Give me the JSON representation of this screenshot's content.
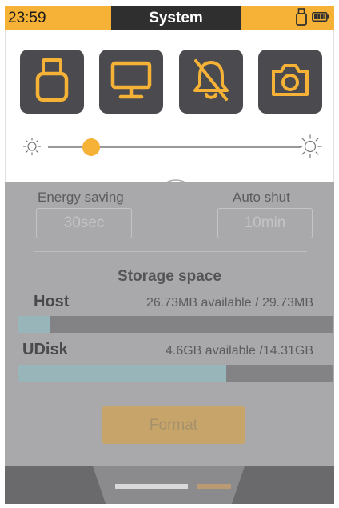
{
  "status_bar": {
    "time": "23:59",
    "title": "System",
    "usb_icon": "usb-drive-icon",
    "battery_icon": "battery-full-icon"
  },
  "quick_panel": {
    "tiles": [
      {
        "name": "usb-drive-tile",
        "icon": "usb-drive-icon"
      },
      {
        "name": "monitor-tile",
        "icon": "monitor-icon"
      },
      {
        "name": "mute-notifications-tile",
        "icon": "bell-off-icon"
      },
      {
        "name": "camera-tile",
        "icon": "camera-icon"
      }
    ],
    "brightness": {
      "level": 0.17,
      "min_icon": "sun-dim-icon",
      "max_icon": "sun-bright-icon"
    },
    "collapse_icon": "chevron-up-icon"
  },
  "settings": {
    "energy_saving_label": "Energy saving",
    "energy_saving_value": "30sec",
    "auto_shut_label": "Auto shut",
    "auto_shut_value": "10min"
  },
  "storage": {
    "title": "Storage space",
    "host": {
      "name": "Host",
      "available": "26.73MB available / 29.73MB",
      "used_fraction": 0.1
    },
    "udisk": {
      "name": "UDisk",
      "available": "4.6GB available /14.31GB",
      "used_fraction": 0.66
    },
    "format_label": "Format"
  },
  "bottom": {
    "page_count": 2,
    "active_page": 1
  },
  "colors": {
    "accent": "#f5b236",
    "tile_bg": "#4b4b4f",
    "title_bg": "#2f2f2f",
    "overlay": "#a9a9ac",
    "progress_fill": "#98b6ba"
  }
}
